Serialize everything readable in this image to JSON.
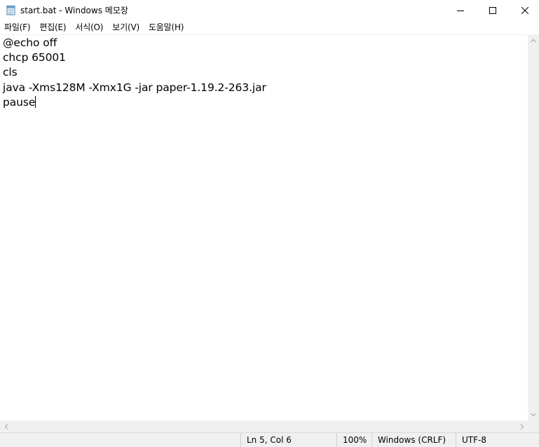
{
  "window": {
    "title": "start.bat - Windows 메모장",
    "icon": "notepad-icon"
  },
  "title_buttons": {
    "minimize_icon": "minimize-icon",
    "maximize_icon": "maximize-icon",
    "close_icon": "close-icon"
  },
  "menu": {
    "items": [
      {
        "label": "파일(F)"
      },
      {
        "label": "편집(E)"
      },
      {
        "label": "서식(O)"
      },
      {
        "label": "보기(V)"
      },
      {
        "label": "도움말(H)"
      }
    ]
  },
  "editor": {
    "lines": [
      "@echo off",
      "chcp 65001",
      "cls",
      "java -Xms128M -Xmx1G -jar paper-1.19.2-263.jar",
      "pause"
    ]
  },
  "status": {
    "position": "Ln 5, Col 6",
    "zoom": "100%",
    "line_ending": "Windows (CRLF)",
    "encoding": "UTF-8"
  }
}
